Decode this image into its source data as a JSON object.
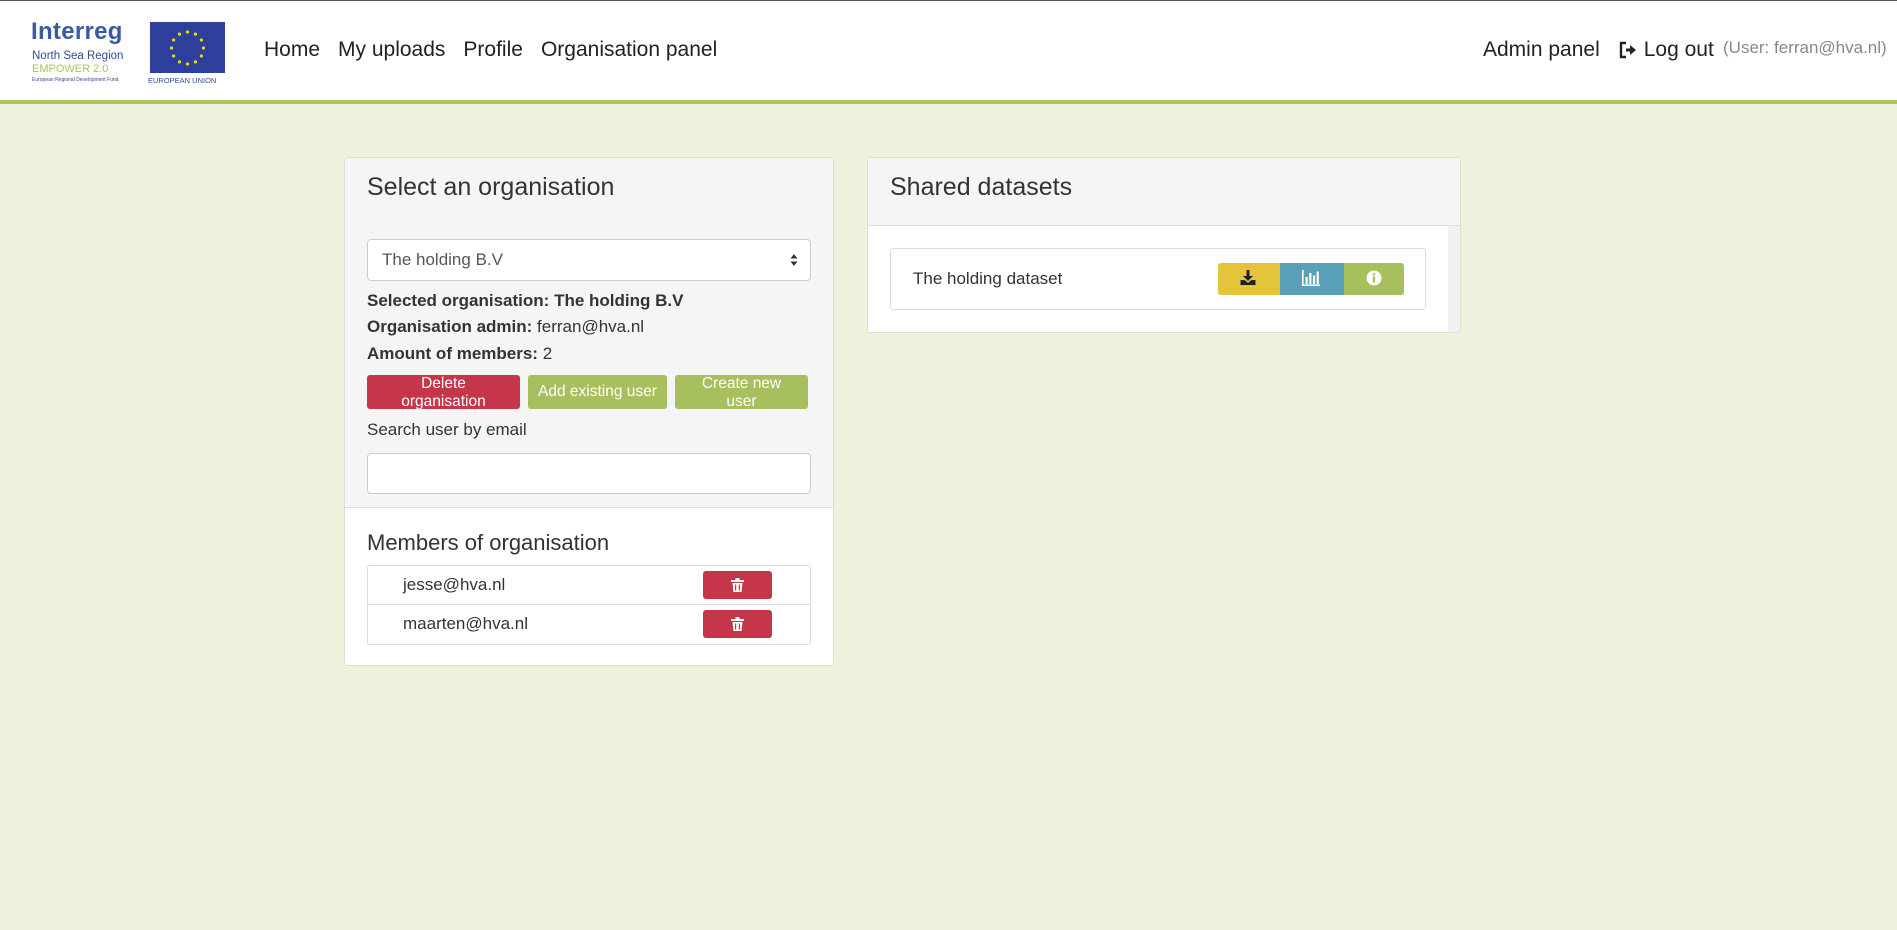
{
  "brand": {
    "logo_title": "Interreg",
    "logo_region": "North Sea Region",
    "logo_project": "EMPOWER 2.0",
    "logo_fund": "European Regional Development Fund",
    "logo_eu": "EUROPEAN UNION"
  },
  "nav": {
    "home": "Home",
    "uploads": "My uploads",
    "profile": "Profile",
    "org_panel": "Organisation panel",
    "admin_panel": "Admin panel",
    "logout": "Log out",
    "user_label": "(User: ferran@hva.nl)"
  },
  "org_panel": {
    "title": "Select an organisation",
    "selected_option": "The holding B.V",
    "selected_label": "Selected organisation:",
    "selected_value": "The holding B.V",
    "admin_label": "Organisation admin:",
    "admin_value": "ferran@hva.nl",
    "members_count_label": "Amount of members:",
    "members_count_value": "2",
    "delete_button": "Delete organisation",
    "add_existing_button": "Add existing user",
    "create_new_button": "Create new user",
    "search_label": "Search user by email",
    "search_value": "",
    "members_title": "Members of organisation",
    "members": [
      {
        "email": "jesse@hva.nl"
      },
      {
        "email": "maarten@hva.nl"
      }
    ]
  },
  "datasets_panel": {
    "title": "Shared datasets",
    "items": [
      {
        "name": "The holding dataset"
      }
    ]
  },
  "colors": {
    "background": "#eef2dd",
    "accent_green": "#a7bf5d",
    "danger_red": "#c5364a",
    "warning_yellow": "#e4c43a",
    "info_blue": "#5a9fb8"
  },
  "icons": {
    "logout": "sign-out-icon",
    "select": "sort-arrows-icon",
    "trash": "trash-icon",
    "download": "download-icon",
    "chart": "bar-chart-icon",
    "info": "info-circle-icon"
  }
}
